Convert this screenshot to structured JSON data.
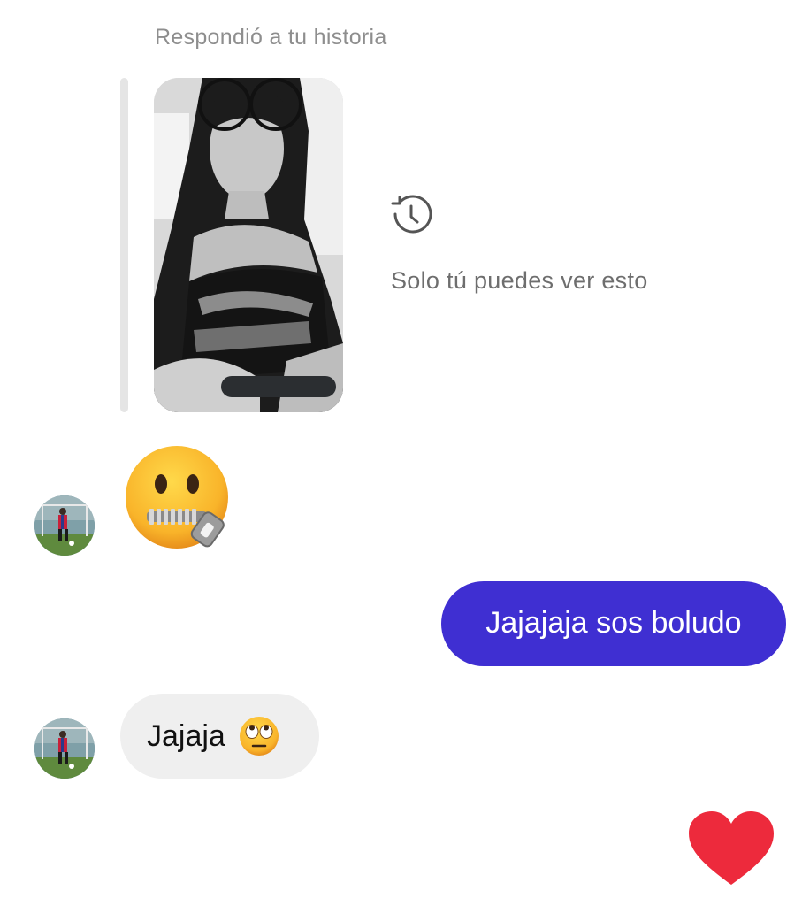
{
  "story_reply": {
    "caption": "Respondió a tu historia",
    "private_notice": "Solo tú puedes ver esto",
    "private_icon": "history-clock-icon"
  },
  "messages": [
    {
      "direction": "incoming",
      "type": "emoji",
      "emoji": "zipper-mouth-face"
    },
    {
      "direction": "outgoing",
      "type": "text",
      "text": "Jajajaja sos boludo"
    },
    {
      "direction": "incoming",
      "type": "text",
      "text": "Jajaja",
      "emoji": "face-with-rolling-eyes"
    },
    {
      "direction": "outgoing",
      "type": "reaction",
      "emoji": "red-heart"
    }
  ],
  "colors": {
    "outgoing_bubble": "#3f2fd2",
    "incoming_bubble": "#efefef",
    "heart": "#ed2a3c",
    "caption_text": "#8e8e8e"
  }
}
